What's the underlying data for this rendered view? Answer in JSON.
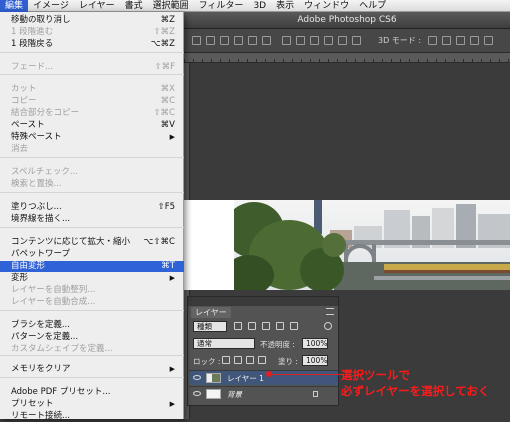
{
  "menubar": {
    "items": [
      "編集",
      "イメージ",
      "レイヤー",
      "書式",
      "選択範囲",
      "フィルター",
      "3D",
      "表示",
      "ウィンドウ",
      "ヘルプ"
    ],
    "active_index": 0
  },
  "window": {
    "title": "Adobe Photoshop CS6",
    "mode_3d_label": "3D モード :"
  },
  "edit_menu": {
    "items": [
      {
        "label": "移動の取り消し",
        "shortcut": "⌘Z",
        "enabled": true
      },
      {
        "label": "1 段階進む",
        "shortcut": "⇧⌘Z",
        "enabled": false
      },
      {
        "label": "1 段階戻る",
        "shortcut": "⌥⌘Z",
        "enabled": true
      },
      {
        "label": "フェード...",
        "shortcut": "⇧⌘F",
        "enabled": false
      },
      {
        "label": "カット",
        "shortcut": "⌘X",
        "enabled": false
      },
      {
        "label": "コピー",
        "shortcut": "⌘C",
        "enabled": false
      },
      {
        "label": "結合部分をコピー",
        "shortcut": "⇧⌘C",
        "enabled": false
      },
      {
        "label": "ペースト",
        "shortcut": "⌘V",
        "enabled": true
      },
      {
        "label": "特殊ペースト",
        "submenu": true,
        "enabled": true
      },
      {
        "label": "消去",
        "enabled": false
      },
      {
        "label": "スペルチェック...",
        "enabled": false
      },
      {
        "label": "検索と置換...",
        "enabled": false
      },
      {
        "label": "塗りつぶし...",
        "shortcut": "⇧F5",
        "enabled": true
      },
      {
        "label": "境界線を描く...",
        "enabled": true
      },
      {
        "label": "コンテンツに応じて拡大・縮小",
        "shortcut": "⌥⇧⌘C",
        "enabled": true
      },
      {
        "label": "パペットワープ",
        "enabled": true
      },
      {
        "label": "自由変形",
        "shortcut": "⌘T",
        "enabled": true,
        "highlighted": true
      },
      {
        "label": "変形",
        "submenu": true,
        "enabled": true
      },
      {
        "label": "レイヤーを自動整列...",
        "enabled": false
      },
      {
        "label": "レイヤーを自動合成...",
        "enabled": false
      },
      {
        "label": "ブラシを定義...",
        "enabled": true
      },
      {
        "label": "パターンを定義...",
        "enabled": true
      },
      {
        "label": "カスタムシェイプを定義...",
        "enabled": false
      },
      {
        "label": "メモリをクリア",
        "submenu": true,
        "enabled": true
      },
      {
        "label": "Adobe PDF プリセット...",
        "enabled": true
      },
      {
        "label": "プリセット",
        "submenu": true,
        "enabled": true
      },
      {
        "label": "リモート接続...",
        "enabled": true
      }
    ]
  },
  "layers_panel": {
    "tab_label": "レイヤー",
    "filter_value": "種類",
    "blend_mode": "通常",
    "opacity_label": "不透明度 :",
    "opacity_value": "100%",
    "lock_label": "ロック :",
    "fill_label": "塗り :",
    "fill_value": "100%",
    "layers": [
      {
        "name": "レイヤー 1",
        "selected": true
      },
      {
        "name": "背景",
        "selected": false,
        "locked": true
      }
    ]
  },
  "annotation": {
    "line1": "選択ツールで",
    "line2": "必ずレイヤーを選択しておく",
    "color": "#ff1a1a"
  },
  "colors": {
    "menu_highlight": "#2f62d6",
    "panel_bg": "#535353",
    "selected_layer": "#40577b"
  }
}
